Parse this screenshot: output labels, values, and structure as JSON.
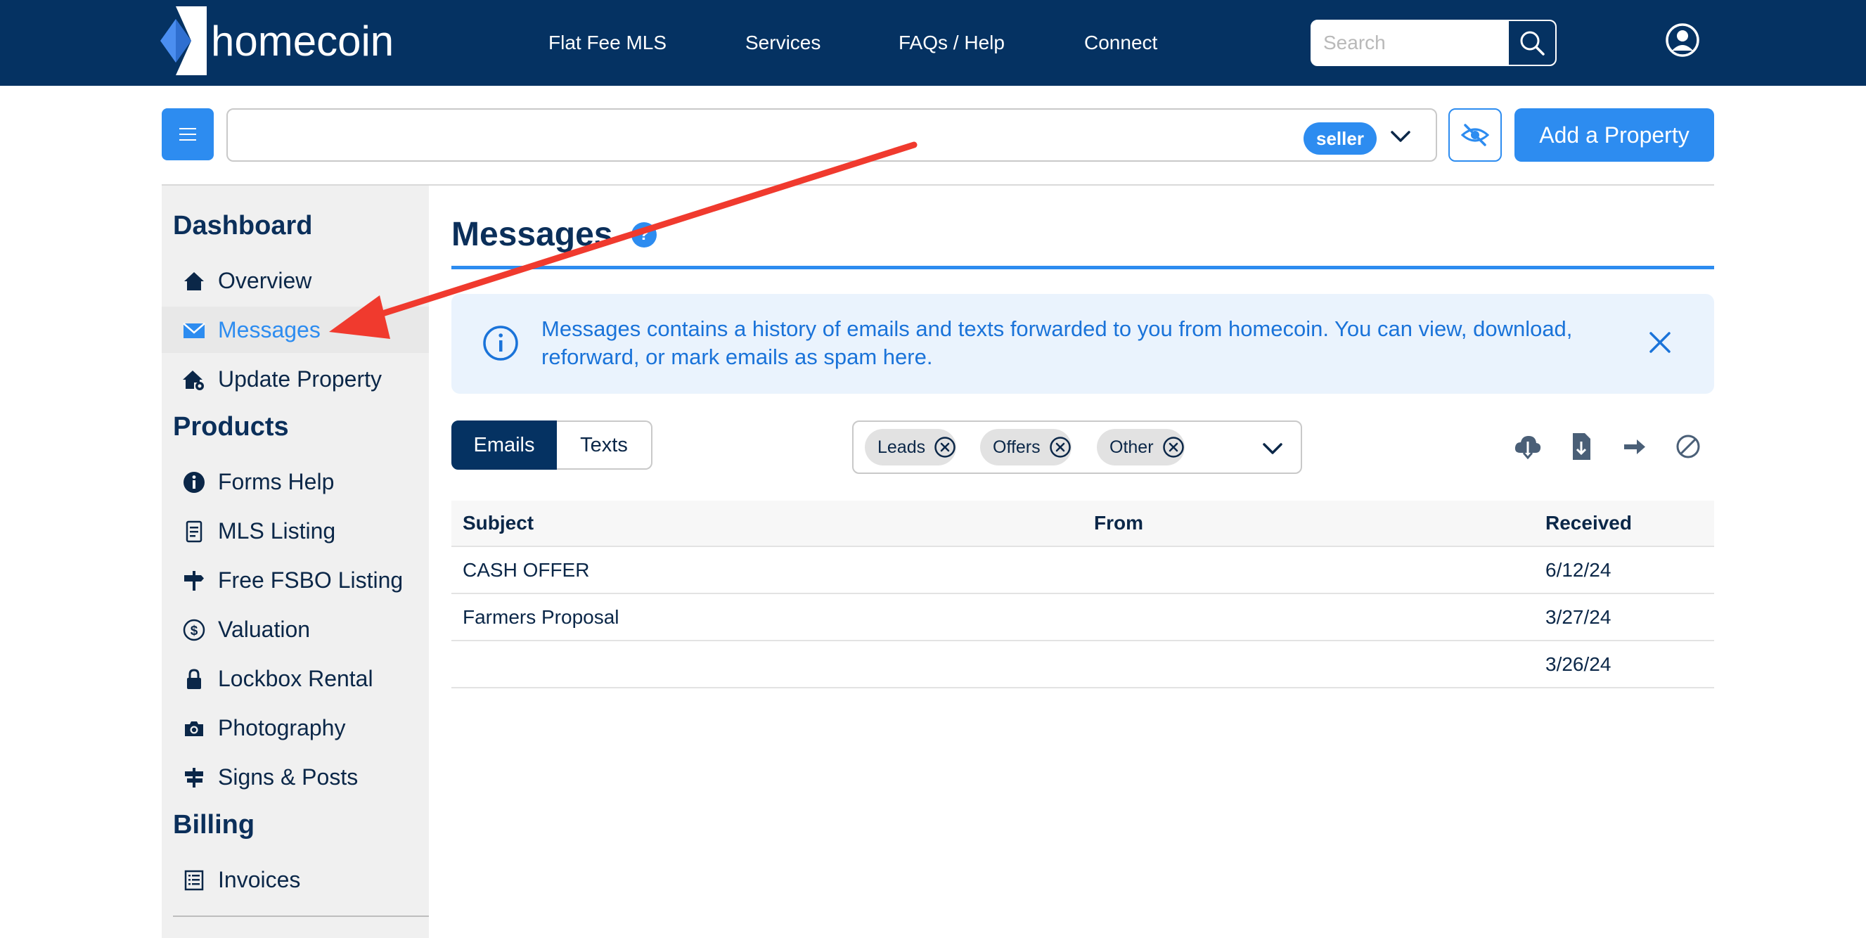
{
  "header": {
    "logo_text": "homecoin",
    "nav": [
      "Flat Fee MLS",
      "Services",
      "FAQs / Help",
      "Connect"
    ],
    "search_placeholder": "Search"
  },
  "property_bar": {
    "role_badge": "seller",
    "add_property_label": "Add a Property"
  },
  "sidebar": {
    "sections": [
      {
        "heading": "Dashboard",
        "items": [
          {
            "label": "Overview",
            "icon": "home-icon"
          },
          {
            "label": "Messages",
            "icon": "envelope-icon",
            "active": true
          },
          {
            "label": "Update Property",
            "icon": "home-gear-icon"
          }
        ]
      },
      {
        "heading": "Products",
        "items": [
          {
            "label": "Forms Help",
            "icon": "info-circle-icon"
          },
          {
            "label": "MLS Listing",
            "icon": "document-icon"
          },
          {
            "label": "Free FSBO Listing",
            "icon": "signpost-icon"
          },
          {
            "label": "Valuation",
            "icon": "dollar-circle-icon"
          },
          {
            "label": "Lockbox Rental",
            "icon": "lock-icon"
          },
          {
            "label": "Photography",
            "icon": "camera-icon"
          },
          {
            "label": "Signs & Posts",
            "icon": "sign-post-icon"
          }
        ]
      },
      {
        "heading": "Billing",
        "items": [
          {
            "label": "Invoices",
            "icon": "invoice-icon"
          }
        ]
      }
    ]
  },
  "main": {
    "title": "Messages",
    "help_badge": "?",
    "info_text": "Messages contains a history of emails and texts forwarded to you from homecoin. You can view, download, reforward, or mark emails as spam here.",
    "tabs": [
      "Emails",
      "Texts"
    ],
    "filters": [
      "Leads",
      "Offers",
      "Other"
    ],
    "table": {
      "columns": [
        "Subject",
        "From",
        "Received"
      ],
      "rows": [
        {
          "subject": "CASH OFFER",
          "from": "",
          "received": "6/12/24"
        },
        {
          "subject": "Farmers Proposal",
          "from": "",
          "received": "3/27/24"
        },
        {
          "subject": "",
          "from": "",
          "received": "3/26/24"
        }
      ]
    }
  },
  "colors": {
    "navbar": "#053262",
    "accent": "#2d8cf0",
    "annotation_arrow": "#f03a2e"
  }
}
